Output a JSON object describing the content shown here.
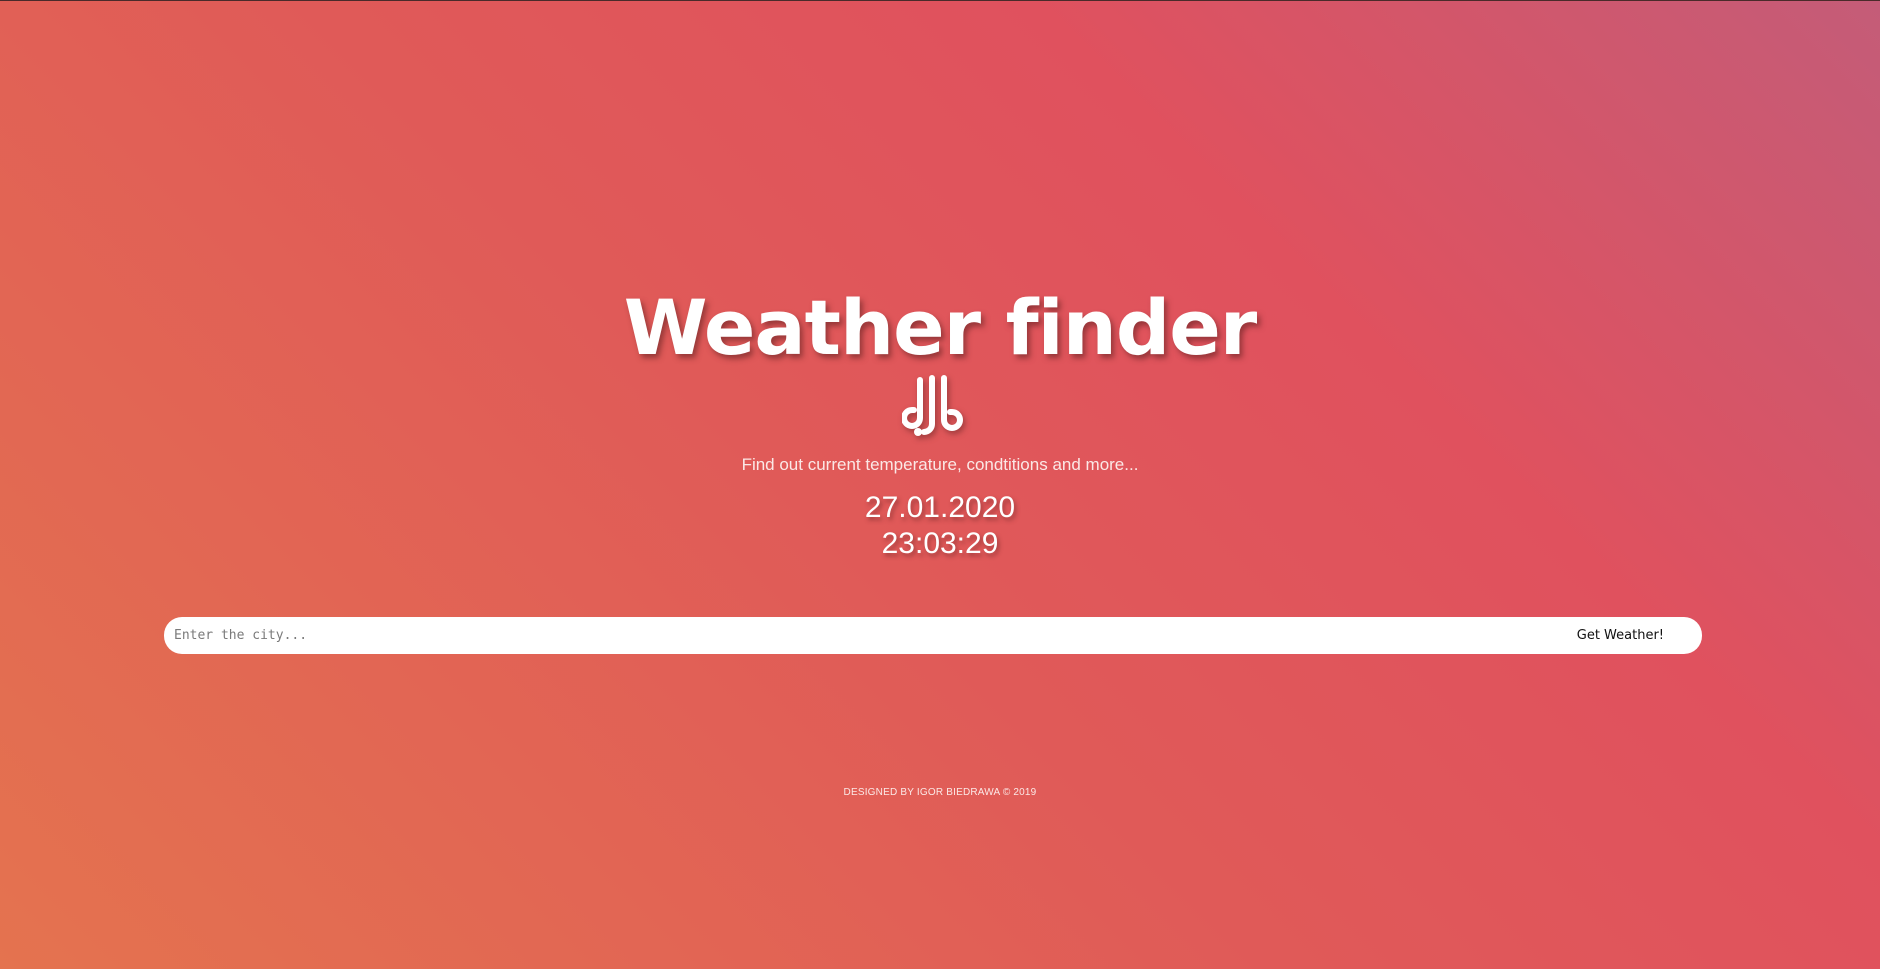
{
  "header": {
    "title": "Weather finder",
    "logo_icon": "db-logo-icon",
    "subtitle": "Find out current temperature, condtitions and more..."
  },
  "clock": {
    "date": "27.01.2020",
    "time": "23:03:29"
  },
  "search": {
    "placeholder": "Enter the city...",
    "value": "",
    "button_label": "Get Weather!"
  },
  "footer": {
    "text": "DESIGNED BY IGOR BIEDRAWA © 2019"
  },
  "colors": {
    "gradient_start": "#e4734f",
    "gradient_mid": "#e05a58",
    "gradient_end": "#c45c78",
    "text": "#ffffff",
    "search_bg": "#ffffff"
  }
}
